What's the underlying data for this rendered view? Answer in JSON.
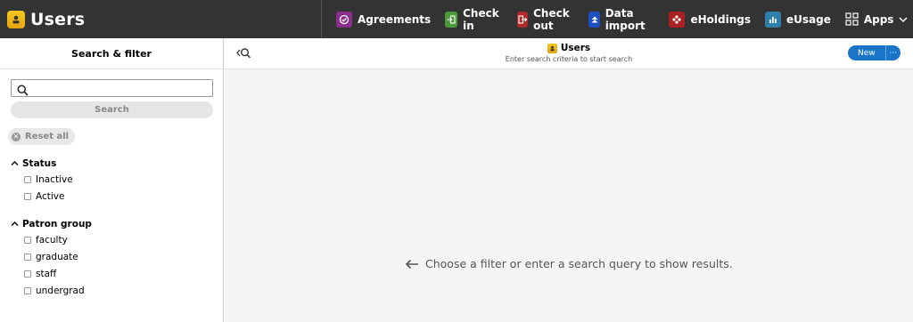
{
  "app": {
    "title": "Users"
  },
  "nav": {
    "items": [
      {
        "label": "Agreements",
        "icon": "agreements-icon",
        "color": "#8a2f8c"
      },
      {
        "label": "Check in",
        "icon": "check-in-icon",
        "color": "#4a9a3a"
      },
      {
        "label": "Check out",
        "icon": "check-out-icon",
        "color": "#b02a2a"
      },
      {
        "label": "Data import",
        "icon": "data-import-icon",
        "color": "#1e4fc1"
      },
      {
        "label": "eHoldings",
        "icon": "eholdings-icon",
        "color": "#a82020"
      },
      {
        "label": "eUsage",
        "icon": "eusage-icon",
        "color": "#2f7fa8"
      }
    ],
    "apps_label": "Apps"
  },
  "filter_pane": {
    "title": "Search & filter",
    "search_placeholder": "",
    "search_button": "Search",
    "reset_button": "Reset all",
    "groups": [
      {
        "label": "Status",
        "options": [
          "Inactive",
          "Active"
        ]
      },
      {
        "label": "Patron group",
        "options": [
          "faculty",
          "graduate",
          "staff",
          "undergrad"
        ]
      }
    ]
  },
  "results_pane": {
    "title": "Users",
    "subtitle": "Enter search criteria to start search",
    "new_button": "New",
    "more_button": "···",
    "empty_message": "Choose a filter or enter a search query to show results."
  },
  "colors": {
    "accent": "#1a74c7",
    "topbar": "#333333"
  }
}
